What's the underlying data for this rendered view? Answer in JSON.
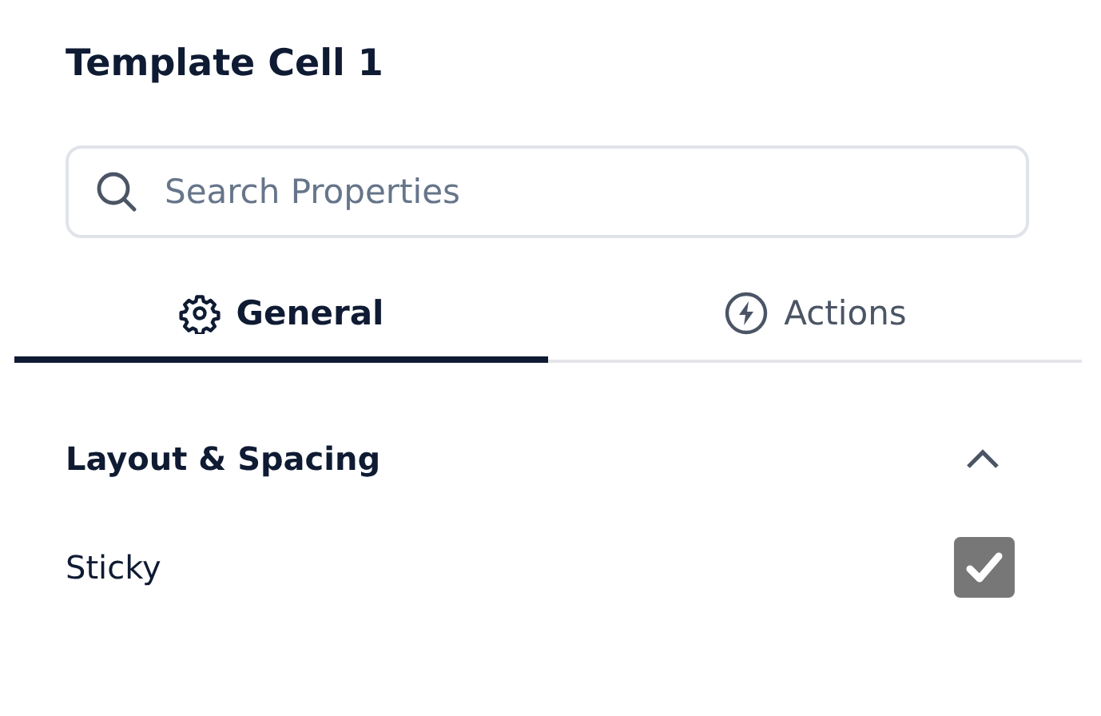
{
  "panel": {
    "title": "Template Cell 1"
  },
  "search": {
    "placeholder": "Search Properties"
  },
  "tabs": [
    {
      "label": "General",
      "selected": true
    },
    {
      "label": "Actions",
      "selected": false
    }
  ],
  "sections": [
    {
      "title": "Layout & Spacing",
      "expanded": true,
      "properties": [
        {
          "label": "Sticky",
          "checked": true
        }
      ]
    }
  ]
}
